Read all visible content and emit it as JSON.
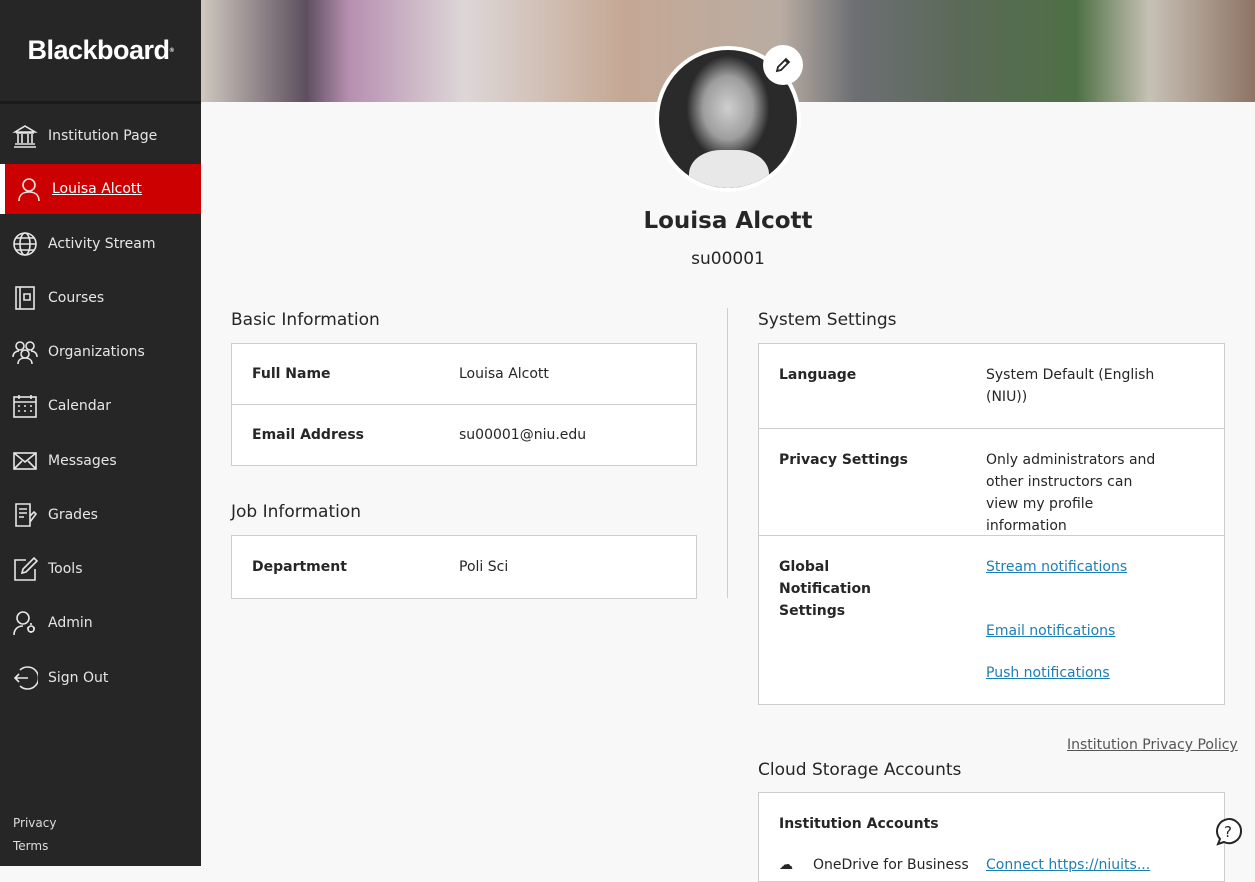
{
  "brand": {
    "logo": "Blackboard"
  },
  "sidebar": {
    "items": [
      {
        "label": "Institution Page",
        "icon": "institution-icon"
      },
      {
        "label": "Louisa Alcott",
        "icon": "user-icon",
        "active": true
      },
      {
        "label": "Activity Stream",
        "icon": "globe-icon"
      },
      {
        "label": "Courses",
        "icon": "book-icon"
      },
      {
        "label": "Organizations",
        "icon": "group-icon"
      },
      {
        "label": "Calendar",
        "icon": "calendar-icon"
      },
      {
        "label": "Messages",
        "icon": "envelope-icon"
      },
      {
        "label": "Grades",
        "icon": "grades-icon"
      },
      {
        "label": "Tools",
        "icon": "tools-icon"
      },
      {
        "label": "Admin",
        "icon": "admin-icon"
      },
      {
        "label": "Sign Out",
        "icon": "sign-out-icon"
      }
    ],
    "footer": {
      "privacy": "Privacy",
      "terms": "Terms"
    }
  },
  "profile": {
    "name": "Louisa Alcott",
    "username": "su00001"
  },
  "basic": {
    "title": "Basic Information",
    "rows": [
      {
        "label": "Full Name",
        "value": "Louisa Alcott"
      },
      {
        "label": "Email Address",
        "value": "su00001@niu.edu"
      }
    ]
  },
  "job": {
    "title": "Job Information",
    "rows": [
      {
        "label": "Department",
        "value": "Poli Sci"
      }
    ]
  },
  "system": {
    "title": "System Settings",
    "language_label": "Language",
    "language_value": "System Default (English (NIU))",
    "privacy_label": "Privacy Settings",
    "privacy_value": "Only administrators and other instructors can view my profile information",
    "notif_label": "Global Notification Settings",
    "links": [
      "Stream notifications",
      "Email notifications",
      "Push notifications"
    ]
  },
  "privacy_policy": "Institution Privacy Policy",
  "cloud": {
    "title": "Cloud Storage Accounts",
    "section": "Institution Accounts",
    "account": "OneDrive for Business",
    "connect": "Connect https://niuits..."
  },
  "colors": {
    "sidebar": "#262626",
    "active": "#cc0000",
    "link": "#1e7eb3"
  }
}
